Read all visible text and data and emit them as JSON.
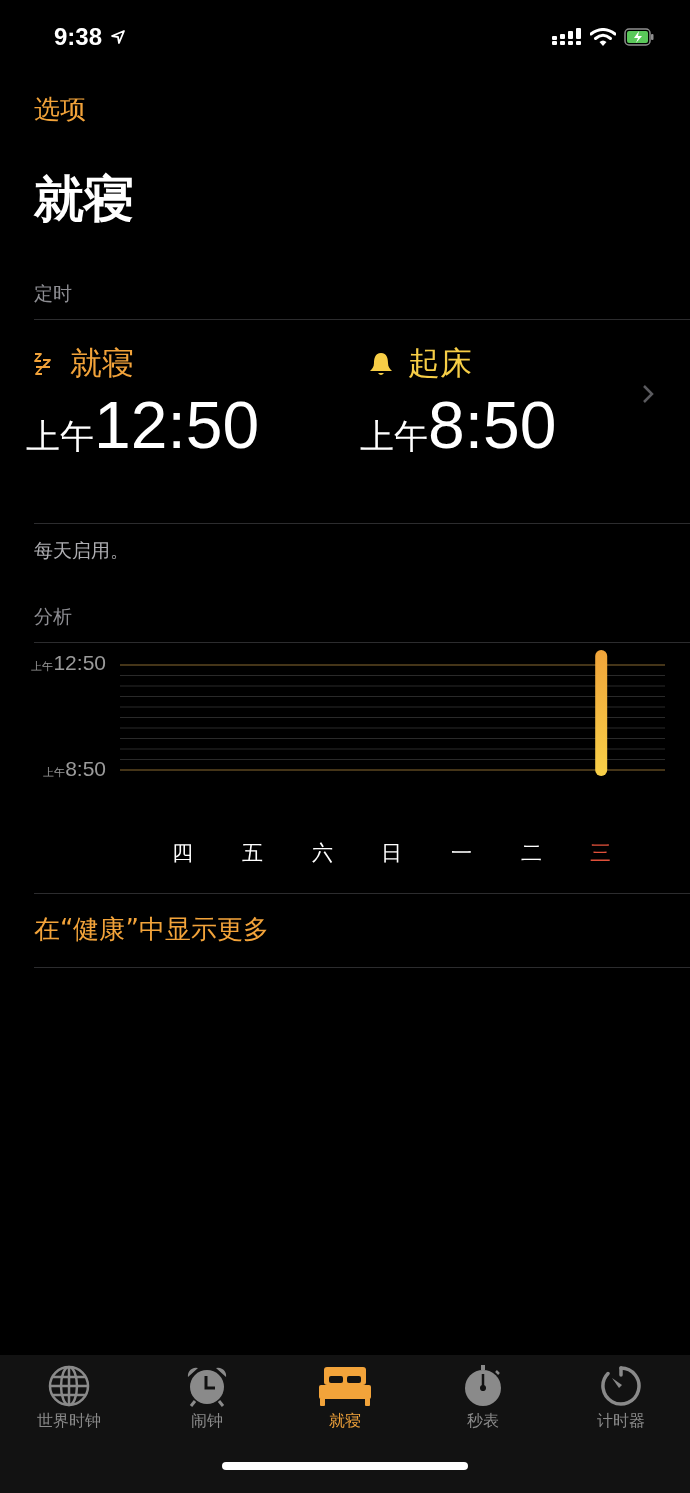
{
  "status_bar": {
    "time": "9:38"
  },
  "nav": {
    "back": "选项",
    "title": "就寝"
  },
  "schedule": {
    "header": "定时",
    "items": [
      {
        "kind": "bedtime",
        "label": "就寝",
        "period": "上午",
        "time": "12:50"
      },
      {
        "kind": "wake",
        "label": "起床",
        "period": "上午",
        "time": "8:50"
      }
    ],
    "note": "每天启用。"
  },
  "analysis": {
    "header": "分析",
    "y_labels": [
      {
        "period": "上午",
        "time": "12:50"
      },
      {
        "period": "上午",
        "time": "8:50"
      }
    ],
    "days": [
      {
        "label": "四",
        "today": false,
        "has_sleep": false
      },
      {
        "label": "五",
        "today": false,
        "has_sleep": false
      },
      {
        "label": "六",
        "today": false,
        "has_sleep": false
      },
      {
        "label": "日",
        "today": false,
        "has_sleep": false
      },
      {
        "label": "一",
        "today": false,
        "has_sleep": false
      },
      {
        "label": "二",
        "today": false,
        "has_sleep": false
      },
      {
        "label": "三",
        "today": true,
        "has_sleep": true
      }
    ],
    "link": "在“健康”中显示更多"
  },
  "tabs": [
    {
      "kind": "globe",
      "label": "世界时钟",
      "selected": false
    },
    {
      "kind": "alarm",
      "label": "闹钟",
      "selected": false
    },
    {
      "kind": "bed",
      "label": "就寝",
      "selected": true
    },
    {
      "kind": "stopwatch",
      "label": "秒表",
      "selected": false
    },
    {
      "kind": "timer",
      "label": "计时器",
      "selected": false
    }
  ]
}
